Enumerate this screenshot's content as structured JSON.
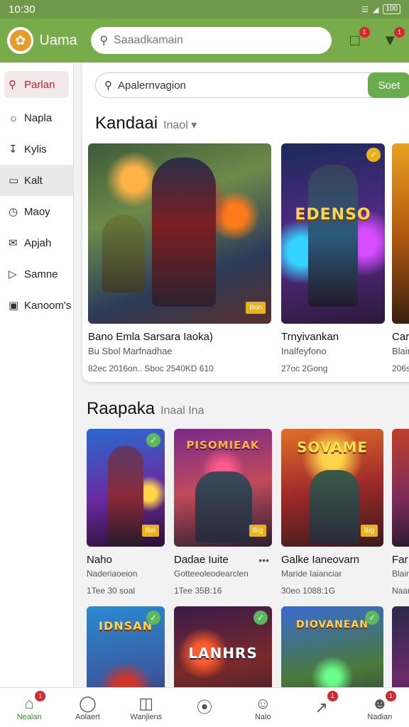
{
  "status": {
    "time": "10:30",
    "battery": "100"
  },
  "header": {
    "app_name": "Uama",
    "search_placeholder": "Saaadkamain",
    "messages_badge": "1",
    "alerts_badge": "1"
  },
  "sidebar": {
    "items": [
      {
        "label": "Parlan",
        "icon": "search-icon"
      },
      {
        "label": "Napla",
        "icon": "compass-icon"
      },
      {
        "label": "Kylis",
        "icon": "download-icon"
      },
      {
        "label": "Kalt",
        "icon": "card-icon"
      },
      {
        "label": "Maoy",
        "icon": "clock-icon"
      },
      {
        "label": "Apjah",
        "icon": "mail-icon"
      },
      {
        "label": "Samne",
        "icon": "tag-icon"
      },
      {
        "label": "Kanoom's",
        "icon": "square-icon"
      }
    ]
  },
  "search": {
    "placeholder": "Apalernvagion",
    "button": "Soet"
  },
  "section1": {
    "title": "Kandaai",
    "subtitle": "Inaol",
    "cards": [
      {
        "name": "Bano Emla Sarsara Iaoka)",
        "meta": "Bu Sbol Marfnadhae",
        "stats": "82ec 2016on..  Sboc 2540KD 610",
        "tag": "Bon",
        "art_title": ""
      },
      {
        "name": "Trnyivankan",
        "meta": "Inalfeyfono",
        "stats": "27oc 2Gong",
        "tag": "",
        "art_title": "EDENSO"
      },
      {
        "name": "Car",
        "meta": "Blair",
        "stats": "206s",
        "tag": "",
        "art_title": ""
      }
    ]
  },
  "section2": {
    "title": "Raapaka",
    "subtitle": "Inaal Ina",
    "cards": [
      {
        "name": "Naho",
        "meta": "Naderiaoeion",
        "stats": "1Tee 30 soal",
        "tag": "Bel",
        "art_title": ""
      },
      {
        "name": "Dadae Iuite",
        "meta": "Gotteeoleodearclen",
        "stats": "1Tee 35B:16",
        "tag": "Big",
        "art_title": "PISOMIEAK"
      },
      {
        "name": "Galke Ianeovarn",
        "meta": "Maride Iaianciar",
        "stats": "30eo 1088:1G",
        "tag": "Big",
        "art_title": "SOVAME"
      },
      {
        "name": "Far",
        "meta": "Blair",
        "stats": "Naar",
        "tag": "",
        "art_title": ""
      }
    ],
    "row2_titles": [
      "IDNSAN",
      "LANHRS",
      "DIOVANEAN"
    ]
  },
  "bottom_nav": {
    "items": [
      {
        "label": "Nealan",
        "icon": "home-icon",
        "badge": "1"
      },
      {
        "label": "Aolaert",
        "icon": "chat-icon",
        "badge": ""
      },
      {
        "label": "Wanjlens",
        "icon": "window-icon",
        "badge": ""
      },
      {
        "label": "",
        "icon": "arrow-circle-icon",
        "badge": ""
      },
      {
        "label": "Nalo",
        "icon": "smile-icon",
        "badge": ""
      },
      {
        "label": "",
        "icon": "trend-icon",
        "badge": "1"
      },
      {
        "label": "Nadian",
        "icon": "user-icon",
        "badge": "1"
      }
    ]
  },
  "colors": {
    "brand_green": "#78ab4a",
    "accent_red": "#c0262c",
    "button_green": "#6aab4e"
  }
}
